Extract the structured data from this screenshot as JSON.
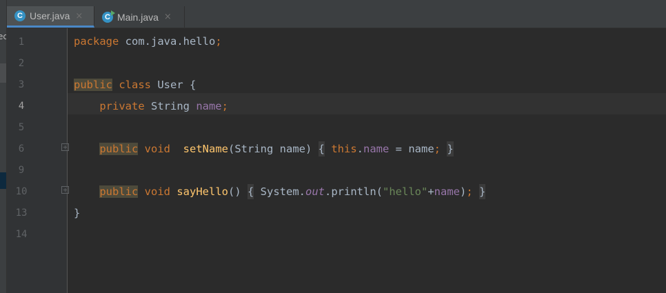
{
  "sidebar": {
    "project_text": "ec"
  },
  "tabs": [
    {
      "label": "User.java",
      "icon": "class-icon",
      "icon_letter": "C",
      "close": "×",
      "active": true
    },
    {
      "label": "Main.java",
      "icon": "runnable-class-icon",
      "icon_letter": "C",
      "close": "×",
      "active": false
    }
  ],
  "gutter": {
    "line_numbers": [
      "1",
      "2",
      "3",
      "4",
      "5",
      "6",
      "9",
      "10",
      "13",
      "14"
    ],
    "current_line": "4",
    "fold_marker": "+"
  },
  "code": {
    "line1": {
      "kw": "package",
      "rest": " com.java.hello",
      "semi": ";"
    },
    "line3": {
      "kw1": "public",
      "kw2": "class",
      "rest": " User {"
    },
    "line4": {
      "indent": "    ",
      "kw": "private",
      "type": " String ",
      "field": "name",
      "semi": ";"
    },
    "line6": {
      "indent": "    ",
      "kw1": "public",
      "kw2": "void",
      "gap": "  ",
      "fn": "setName",
      "params": "(String name) ",
      "open": "{",
      "this": "this",
      "dot": ".",
      "field": "name",
      "assign": " = name",
      "semi": ";",
      "close": "}"
    },
    "line10": {
      "indent": "    ",
      "kw1": "public",
      "kw2": "void",
      "fn": "sayHello",
      "parens": "() ",
      "open": "{",
      "sys": " System.",
      "out": "out",
      "println": ".println(",
      "str": "\"hello\"",
      "plus": "+",
      "field": "name",
      "end": ")",
      "semi": ";",
      "close": "}"
    },
    "line13": {
      "text": "}"
    }
  },
  "colors": {
    "background": "#2b2b2b",
    "keyword": "#cc7832",
    "field": "#9876aa",
    "method": "#ffc66d",
    "string": "#6a8759",
    "default_text": "#a9b7c6",
    "tab_underline": "#4a88c7"
  }
}
